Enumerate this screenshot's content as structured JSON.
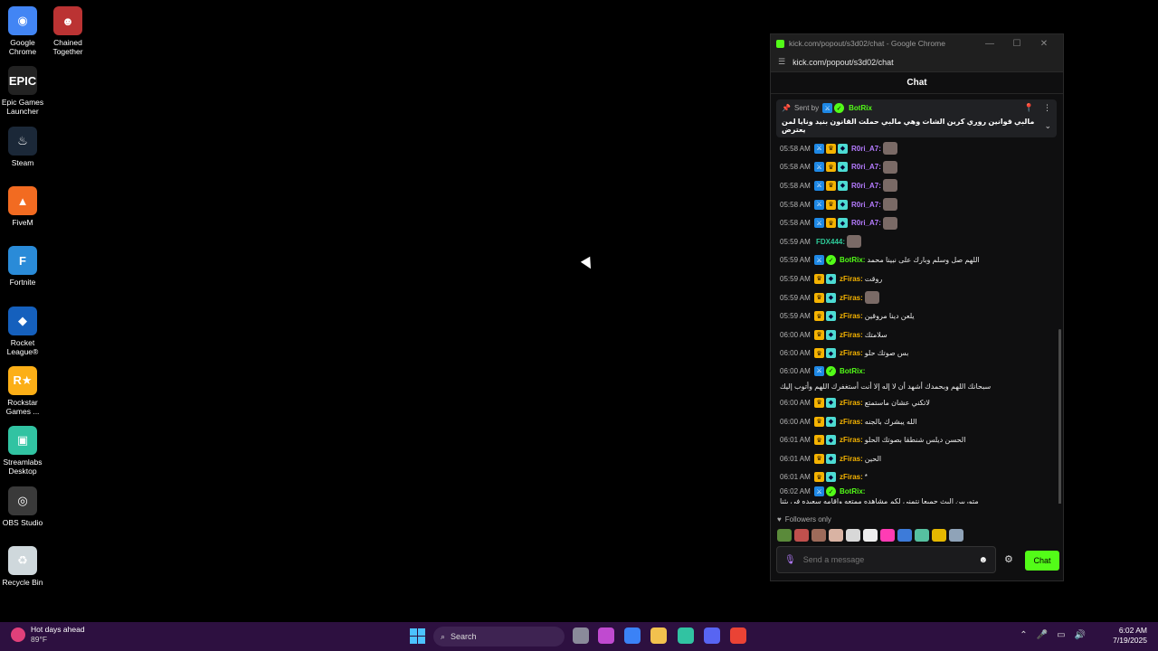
{
  "desktop": {
    "icons": [
      {
        "label": "Google Chrome",
        "icon": "chrome-icon",
        "color": "#4285f4",
        "glyph": "◉"
      },
      {
        "label": "Chained Together",
        "icon": "chained-together-icon",
        "color": "#b33",
        "glyph": "☻"
      },
      {
        "label": "Epic Games Launcher",
        "icon": "epic-games-icon",
        "color": "#222",
        "glyph": "EPIC"
      },
      {
        "label": "Steam",
        "icon": "steam-icon",
        "color": "#1b2838",
        "glyph": "♨"
      },
      {
        "label": "FiveM",
        "icon": "fivem-icon",
        "color": "#f26b21",
        "glyph": "▲"
      },
      {
        "label": "Fortnite",
        "icon": "fortnite-icon",
        "color": "#2a8bd8",
        "glyph": "F"
      },
      {
        "label": "Rocket League®",
        "icon": "rocket-league-icon",
        "color": "#1560bd",
        "glyph": "◆"
      },
      {
        "label": "Rockstar Games ...",
        "icon": "rockstar-icon",
        "color": "#fcaf17",
        "glyph": "R★"
      },
      {
        "label": "Streamlabs Desktop",
        "icon": "streamlabs-icon",
        "color": "#31c3a2",
        "glyph": "▣"
      },
      {
        "label": "OBS Studio",
        "icon": "obs-icon",
        "color": "#3a3a3a",
        "glyph": "◎"
      },
      {
        "label": "Recycle Bin",
        "icon": "recycle-bin-icon",
        "color": "#cfd8dc",
        "glyph": "♻"
      }
    ]
  },
  "window": {
    "title": "kick.com/popout/s3d02/chat - Google Chrome",
    "url": "kick.com/popout/s3d02/chat",
    "chat_header": "Chat"
  },
  "pinned": {
    "sent_by": "Sent by",
    "user": "BotRix",
    "message": "مالبي قوانين روري كرين الشات وهي مالبي حملت القانون بنيد ونايا لمن يعترض"
  },
  "messages": [
    {
      "time": "05:58 AM",
      "badges": [
        "mod",
        "vip",
        "sub"
      ],
      "user": "R0ri_A7:",
      "color": "#b57bff",
      "text": "",
      "emote": true
    },
    {
      "time": "05:58 AM",
      "badges": [
        "mod",
        "vip",
        "sub"
      ],
      "user": "R0ri_A7:",
      "color": "#b57bff",
      "text": "",
      "emote": true
    },
    {
      "time": "05:58 AM",
      "badges": [
        "mod",
        "vip",
        "sub"
      ],
      "user": "R0ri_A7:",
      "color": "#b57bff",
      "text": "",
      "emote": true
    },
    {
      "time": "05:58 AM",
      "badges": [
        "mod",
        "vip",
        "sub"
      ],
      "user": "R0ri_A7:",
      "color": "#b57bff",
      "text": "",
      "emote": true
    },
    {
      "time": "05:58 AM",
      "badges": [
        "mod",
        "vip",
        "sub"
      ],
      "user": "R0ri_A7:",
      "color": "#b57bff",
      "text": "",
      "emote": true
    },
    {
      "time": "05:59 AM",
      "badges": [],
      "user": "FDX444:",
      "color": "#2ecc9a",
      "text": "",
      "emote": true
    },
    {
      "time": "05:59 AM",
      "badges": [
        "mod",
        "verified"
      ],
      "user": "BotRix:",
      "color": "#53fc18",
      "text": "اللهم صل وسلم وبارك على نبينا محمد",
      "emote": false
    },
    {
      "time": "05:59 AM",
      "badges": [
        "vip",
        "sub"
      ],
      "user": "zFiras:",
      "color": "#f5b301",
      "text": "روقت",
      "emote": false
    },
    {
      "time": "05:59 AM",
      "badges": [
        "vip",
        "sub"
      ],
      "user": "zFiras:",
      "color": "#f5b301",
      "text": "",
      "emote": true
    },
    {
      "time": "05:59 AM",
      "badges": [
        "vip",
        "sub"
      ],
      "user": "zFiras:",
      "color": "#f5b301",
      "text": "يلعن دينا مروقين",
      "emote": false
    },
    {
      "time": "06:00 AM",
      "badges": [
        "vip",
        "sub"
      ],
      "user": "zFiras:",
      "color": "#f5b301",
      "text": "سلامتك",
      "emote": false
    },
    {
      "time": "06:00 AM",
      "badges": [
        "vip",
        "sub"
      ],
      "user": "zFiras:",
      "color": "#f5b301",
      "text": "بس صوتك حلو",
      "emote": false
    },
    {
      "time": "06:00 AM",
      "badges": [
        "mod",
        "verified"
      ],
      "user": "BotRix:",
      "color": "#53fc18",
      "text": "سبحانك اللهم وبحمدك أشهد أن لا إله إلا أنت أستغفرك اللهم وأتوب إليك",
      "emote": false,
      "tall": true
    },
    {
      "time": "06:00 AM",
      "badges": [
        "vip",
        "sub"
      ],
      "user": "zFiras:",
      "color": "#f5b301",
      "text": "لاتكني عشان ماستمتع",
      "emote": false
    },
    {
      "time": "06:00 AM",
      "badges": [
        "vip",
        "sub"
      ],
      "user": "zFiras:",
      "color": "#f5b301",
      "text": "الله يبشرك بالجنه",
      "emote": false
    },
    {
      "time": "06:01 AM",
      "badges": [
        "vip",
        "sub"
      ],
      "user": "zFiras:",
      "color": "#f5b301",
      "text": "الحسن ديلس شنطقا بصوتك الحلو",
      "emote": false
    },
    {
      "time": "06:01 AM",
      "badges": [
        "vip",
        "sub"
      ],
      "user": "zFiras:",
      "color": "#f5b301",
      "text": "الحين",
      "emote": false
    },
    {
      "time": "06:01 AM",
      "badges": [
        "vip",
        "sub"
      ],
      "user": "zFiras:",
      "color": "#f5b301",
      "text": "*",
      "emote": false
    },
    {
      "time": "06:02 AM",
      "badges": [
        "mod",
        "verified"
      ],
      "user": "BotRix:",
      "color": "#53fc18",
      "text": "متوريين البث جميعا نتمنى لكم مشاهده ممتعه وإقامه سعيده في بثنا",
      "emote": false
    }
  ],
  "followers_only": "Followers only",
  "emote_colors": [
    "#5a8a3a",
    "#c0504d",
    "#9e6b5a",
    "#d9b3a3",
    "#d8d8d8",
    "#eeeeee",
    "#ff3cb4",
    "#3d7bd9",
    "#56c0a0",
    "#e5b800",
    "#8fa3b8"
  ],
  "composer": {
    "placeholder": "Send a message",
    "send_label": "Chat"
  },
  "taskbar": {
    "weather_title": "Hot days ahead",
    "weather_temp": "89°F",
    "search_label": "Search",
    "time": "6:02 AM",
    "date": "7/19/2025",
    "apps": [
      {
        "icon": "task-view-icon",
        "color": "#8a8a9a"
      },
      {
        "icon": "copilot-icon",
        "color": "#c04ad0"
      },
      {
        "icon": "store-icon",
        "color": "#3b82f6"
      },
      {
        "icon": "file-explorer-icon",
        "color": "#f2c14e"
      },
      {
        "icon": "streamlabs-taskbar-icon",
        "color": "#31c3a2"
      },
      {
        "icon": "discord-icon",
        "color": "#5865f2"
      },
      {
        "icon": "chrome-taskbar-icon",
        "color": "#ea4335"
      }
    ]
  }
}
